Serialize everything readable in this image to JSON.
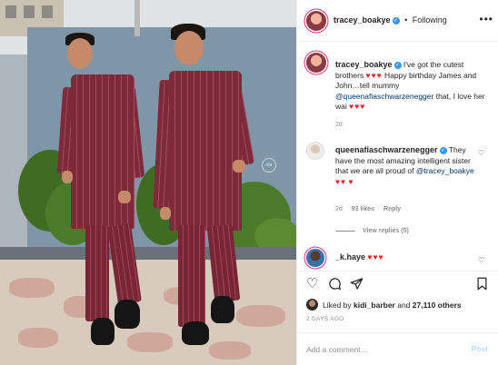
{
  "post": {
    "photo_alt": "",
    "watermark": "ofa"
  },
  "header": {
    "username": "tracey_boakye",
    "separator": "•",
    "follow_status": "Following",
    "more": "•••"
  },
  "caption": {
    "username": "tracey_boakye",
    "text_1": " I've got the cutest brothers ",
    "hearts_1": "♥♥♥",
    "text_2": " Happy birthday James and John…tell mummy ",
    "mention": "@queenafiaschwarzenegger",
    "text_3": " that, I love her wai ",
    "hearts_2": "♥♥♥",
    "time": "2d"
  },
  "comment_1": {
    "username": "queenafiaschwarzenegger",
    "text_1": " They have the most amazing intelligent sister that we are all proud of ",
    "mention": "@tracey_boakye",
    "hearts": "♥♥",
    "hearts_2": "♥",
    "time": "2d",
    "likes": "93 likes",
    "reply": "Reply",
    "view_replies": "View replies (5)"
  },
  "comment_2": {
    "username": "_k.haye",
    "hearts": "♥♥♥"
  },
  "actions": {
    "like_icon": "heart-icon",
    "comment_icon": "comment-icon",
    "share_icon": "share-icon",
    "save_icon": "bookmark-icon"
  },
  "likes": {
    "prefix": "Liked by ",
    "user": "kidi_barber",
    "middle": " and ",
    "count": "27,110 others"
  },
  "date": "2 DAYS AGO",
  "add_comment": {
    "placeholder": "Add a comment…",
    "post_label": "Post"
  },
  "colors": {
    "verified": "#3897f0",
    "heart": "#ed1d24",
    "mention": "#00376b",
    "post_disabled": "#b2dffc"
  }
}
